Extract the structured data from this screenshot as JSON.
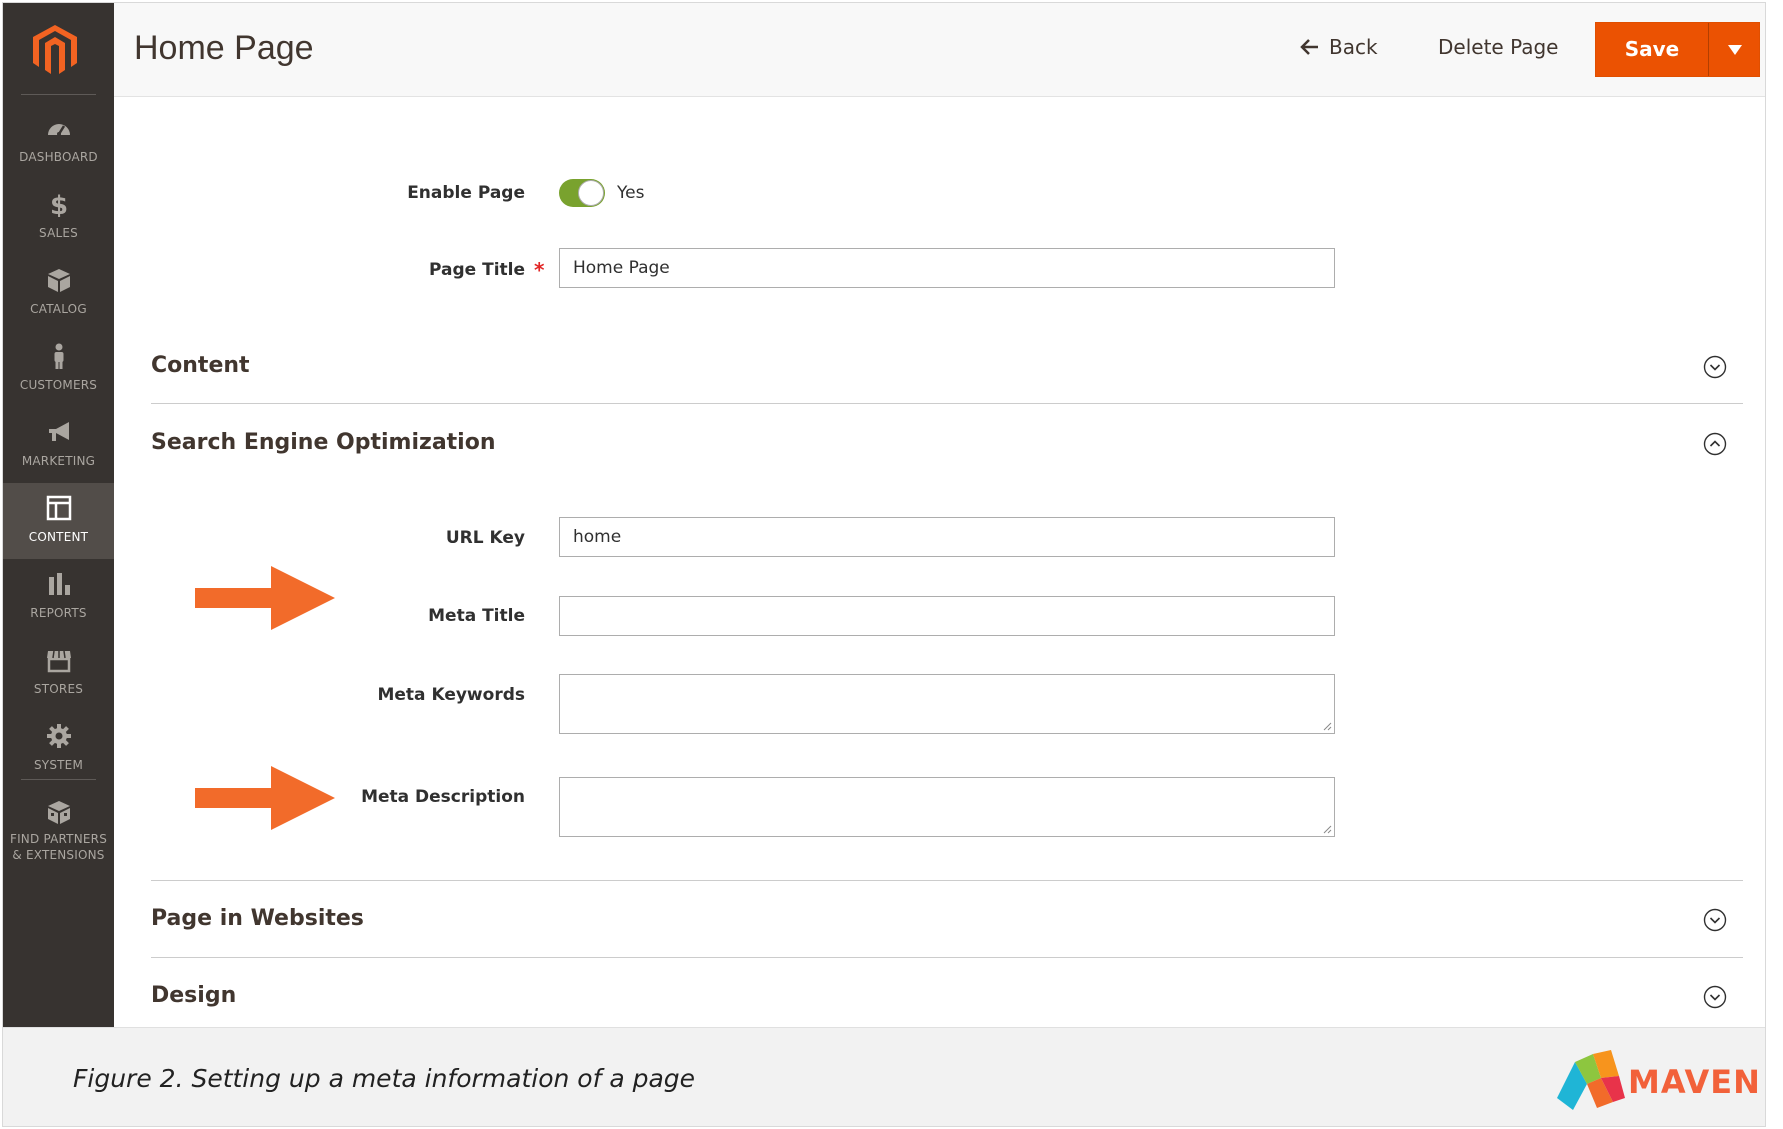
{
  "sidebar": {
    "items": [
      {
        "label": "DASHBOARD",
        "icon": "dashboard-icon"
      },
      {
        "label": "SALES",
        "icon": "dollar-icon"
      },
      {
        "label": "CATALOG",
        "icon": "box-icon"
      },
      {
        "label": "CUSTOMERS",
        "icon": "person-icon"
      },
      {
        "label": "MARKETING",
        "icon": "megaphone-icon"
      },
      {
        "label": "CONTENT",
        "icon": "layout-icon"
      },
      {
        "label": "REPORTS",
        "icon": "bar-chart-icon"
      },
      {
        "label": "STORES",
        "icon": "storefront-icon"
      },
      {
        "label": "SYSTEM",
        "icon": "gear-icon"
      },
      {
        "label_line1": "FIND PARTNERS",
        "label_line2": "& EXTENSIONS",
        "icon": "partners-box-icon"
      }
    ],
    "active": "CONTENT"
  },
  "header": {
    "title": "Home Page",
    "back_label": "Back",
    "delete_label": "Delete Page",
    "save_label": "Save"
  },
  "form": {
    "enable_page": {
      "label": "Enable Page",
      "value": "Yes",
      "on": true
    },
    "page_title": {
      "label": "Page Title",
      "value": "Home Page",
      "required": true
    }
  },
  "sections": {
    "content": {
      "title": "Content",
      "expanded": false
    },
    "seo": {
      "title": "Search Engine Optimization",
      "expanded": true,
      "url_key": {
        "label": "URL Key",
        "value": "home"
      },
      "meta_title": {
        "label": "Meta Title",
        "value": ""
      },
      "meta_keywords": {
        "label": "Meta Keywords",
        "value": ""
      },
      "meta_description": {
        "label": "Meta Description",
        "value": ""
      }
    },
    "websites": {
      "title": "Page in Websites",
      "expanded": false
    },
    "design": {
      "title": "Design",
      "expanded": false
    }
  },
  "caption": {
    "text": "Figure 2. Setting up a meta information of a page",
    "brand": "MAVEN"
  },
  "colors": {
    "sidebar_bg": "#373330",
    "sidebar_active": "#524d49",
    "save_orange": "#eb5202",
    "toggle_green": "#79a22e",
    "annotation_arrow": "#f26b2a",
    "brand_orange": "#f2613a"
  }
}
